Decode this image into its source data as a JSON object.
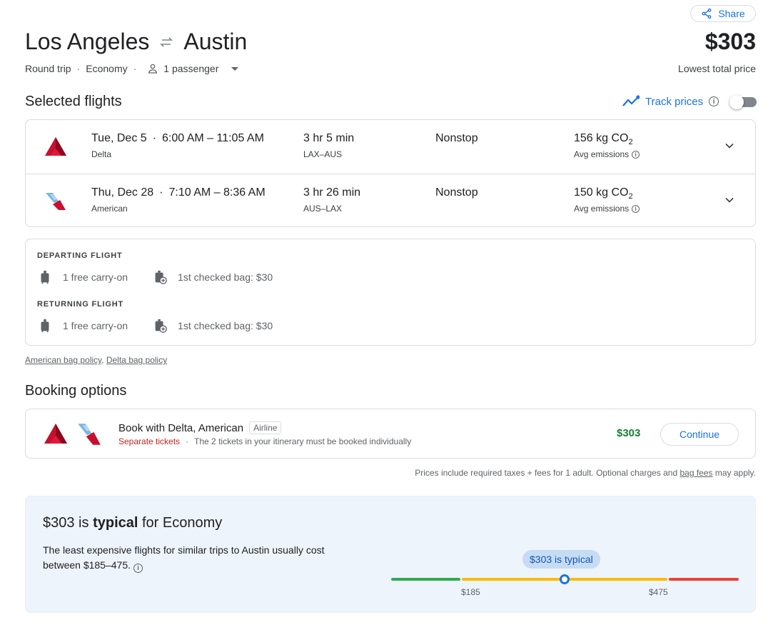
{
  "header": {
    "share_label": "Share",
    "origin": "Los Angeles",
    "destination": "Austin",
    "trip_type": "Round trip",
    "cabin": "Economy",
    "passengers": "1 passenger",
    "price": "$303",
    "price_label": "Lowest total price"
  },
  "selected": {
    "title": "Selected flights",
    "track_label": "Track prices",
    "track_enabled": false,
    "flights": [
      {
        "date": "Tue, Dec 5",
        "times": "6:00 AM – 11:05 AM",
        "airline": "Delta",
        "duration": "3 hr 5 min",
        "airports": "LAX–AUS",
        "stops": "Nonstop",
        "co2": "156 kg CO",
        "co2_sub": "2",
        "emissions": "Avg emissions"
      },
      {
        "date": "Thu, Dec 28",
        "times": "7:10 AM – 8:36 AM",
        "airline": "American",
        "duration": "3 hr 26 min",
        "airports": "AUS–LAX",
        "stops": "Nonstop",
        "co2": "150 kg CO",
        "co2_sub": "2",
        "emissions": "Avg emissions"
      }
    ]
  },
  "bags": {
    "departing_label": "DEPARTING FLIGHT",
    "returning_label": "RETURNING FLIGHT",
    "departing_carry": "1 free carry-on",
    "departing_checked": "1st checked bag: $30",
    "returning_carry": "1 free carry-on",
    "returning_checked": "1st checked bag: $30",
    "policy_american": "American bag policy",
    "policy_delta": "Delta bag policy"
  },
  "booking": {
    "title": "Booking options",
    "book_with": "Book with Delta, American",
    "badge": "Airline",
    "separate": "Separate tickets",
    "note": "The 2 tickets in your itinerary must be booked individually",
    "price": "$303",
    "continue_label": "Continue",
    "fine_print_prefix": "Prices include required taxes + fees for 1 adult. Optional charges and ",
    "fine_print_link": "bag fees",
    "fine_print_suffix": " may apply."
  },
  "insight": {
    "price": "$303",
    "is": " is ",
    "level": "typical",
    "suffix": " for Economy",
    "text": "The least expensive flights for similar trips to Austin usually cost between $185–475.",
    "pill": "$303 is typical",
    "low_tick": "$185",
    "high_tick": "$475"
  },
  "colors": {
    "accent": "#1a73e8",
    "price_green": "#188038",
    "warning_red": "#c5221f",
    "delta_red": "#c8102e"
  }
}
